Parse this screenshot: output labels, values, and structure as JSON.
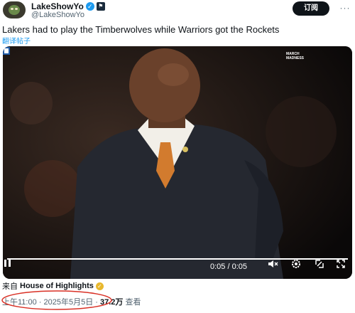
{
  "account": {
    "display_name": "LakeShowYo",
    "handle": "@LakeShowYo",
    "verified_icon": "verified-check-icon",
    "affiliate_icon": "affiliate-badge-icon"
  },
  "actions": {
    "follow_label": "订阅",
    "more_label": "···"
  },
  "tweet": {
    "text": "Lakers had to play the Timberwolves while Warriors got the Rockets",
    "translate_label": "翻译帖子"
  },
  "media": {
    "logo_line1": "MARCH",
    "logo_line2": "MADNESS",
    "time_display": "0:05 / 0:05",
    "progress": 1.0,
    "controls": [
      "pause-icon",
      "volume-muted-icon",
      "settings-gear-icon",
      "fullscreen-icon",
      "expand-icon"
    ]
  },
  "source": {
    "prefix": "来自",
    "name": "House of Highlights",
    "badge_icon": "gold-verified-icon"
  },
  "meta": {
    "timestamp": "上午11:00 · 2025年5月5日",
    "separator": " · ",
    "views_count": "37.2万",
    "views_label": "查看"
  },
  "colors": {
    "link": "#1d9bf0",
    "secondary_text": "#536471",
    "follow_bg": "#0f1419",
    "annotation_red": "#d93025"
  }
}
